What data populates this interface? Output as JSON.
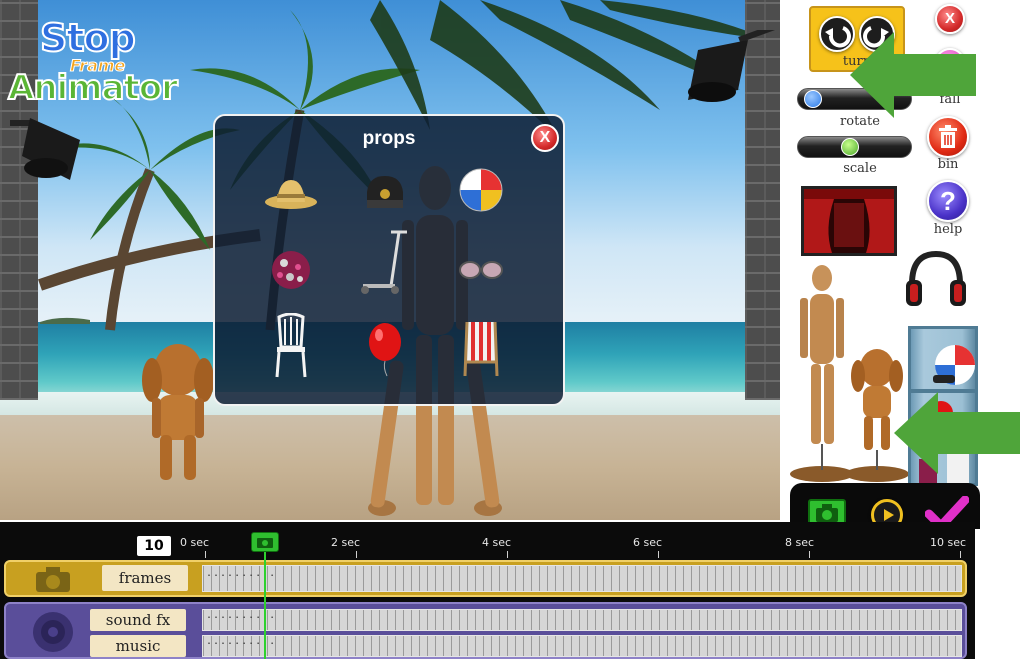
{
  "app": {
    "logo_line1": "Stop",
    "logo_line2": "Frame",
    "logo_line3": "Animator"
  },
  "props_dialog": {
    "title": "props",
    "close_label": "X",
    "items": [
      {
        "name": "straw-hat"
      },
      {
        "name": "helmet"
      },
      {
        "name": "beach-ball"
      },
      {
        "name": "pom-pom"
      },
      {
        "name": "scooter"
      },
      {
        "name": "sunglasses"
      },
      {
        "name": "chair"
      },
      {
        "name": "balloon"
      },
      {
        "name": "deck-chair"
      }
    ]
  },
  "right_panel": {
    "turn_label": "turn",
    "close_label": "X",
    "fall_label": "fall",
    "rotate_label": "rotate",
    "rotate_value": 0.05,
    "scale_label": "scale",
    "scale_value": 0.45,
    "bin_label": "bin",
    "help_label": "help",
    "help_symbol": "?"
  },
  "timeline": {
    "fps": "10",
    "ticks": [
      "0 sec",
      "2 sec",
      "4 sec",
      "6 sec",
      "8 sec",
      "10 sec"
    ],
    "tracks": {
      "frames_label": "frames",
      "soundfx_label": "sound fx",
      "music_label": "music",
      "frames_dots": "..........",
      "soundfx_dots": "..........",
      "music_dots": ".........."
    }
  },
  "colors": {
    "accent_green": "#2fbf2f",
    "frames_track": "#c8a020",
    "audio_track": "#5a4e9a",
    "confirm_pink": "#e030c8",
    "tutorial_arrow": "#4fa53a"
  }
}
